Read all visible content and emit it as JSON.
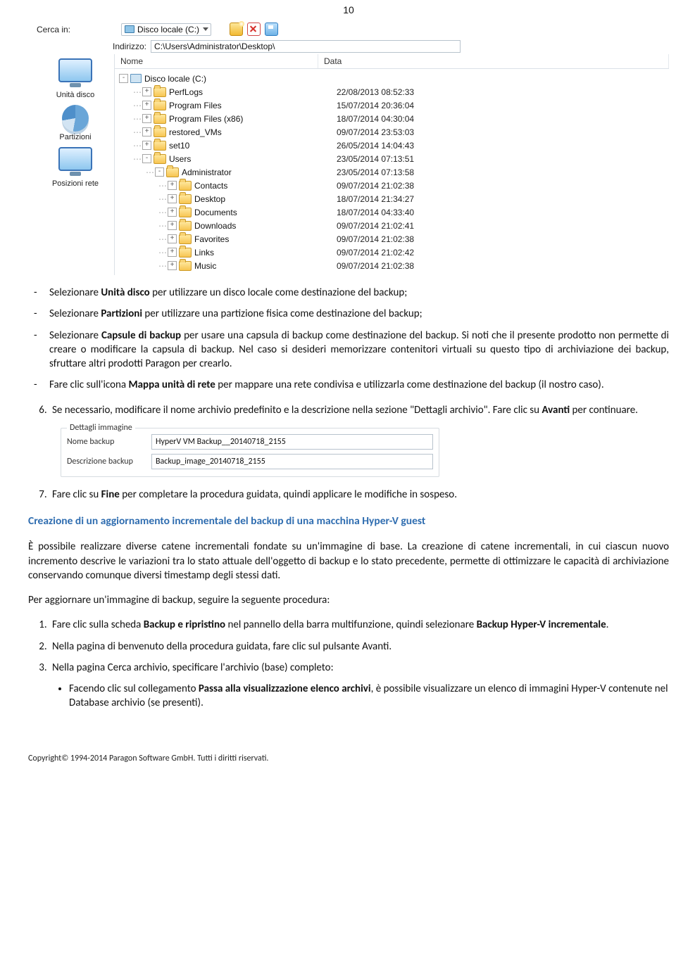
{
  "page_number": "10",
  "browser": {
    "search_label": "Cerca in:",
    "drive_name": "Disco locale (C:)",
    "addr_label": "Indirizzo:",
    "addr_value": "C:\\Users\\Administrator\\Desktop\\",
    "col_name": "Nome",
    "col_data": "Data"
  },
  "side": {
    "unit": "Unità disco",
    "part": "Partizioni",
    "net": "Posizioni rete"
  },
  "tree": [
    {
      "indent": 0,
      "exp": "-",
      "icon": "drive",
      "name": "Disco locale (C:)",
      "date": ""
    },
    {
      "indent": 1,
      "exp": "+",
      "icon": "folder",
      "name": "PerfLogs",
      "date": "22/08/2013 08:52:33"
    },
    {
      "indent": 1,
      "exp": "+",
      "icon": "folder",
      "name": "Program Files",
      "date": "15/07/2014 20:36:04"
    },
    {
      "indent": 1,
      "exp": "+",
      "icon": "folder",
      "name": "Program Files (x86)",
      "date": "18/07/2014 04:30:04"
    },
    {
      "indent": 1,
      "exp": "+",
      "icon": "folder",
      "name": "restored_VMs",
      "date": "09/07/2014 23:53:03"
    },
    {
      "indent": 1,
      "exp": "+",
      "icon": "folder",
      "name": "set10",
      "date": "26/05/2014 14:04:43"
    },
    {
      "indent": 1,
      "exp": "-",
      "icon": "folder",
      "name": "Users",
      "date": "23/05/2014 07:13:51"
    },
    {
      "indent": 2,
      "exp": "-",
      "icon": "folder",
      "name": "Administrator",
      "date": "23/05/2014 07:13:58"
    },
    {
      "indent": 3,
      "exp": "+",
      "icon": "folder",
      "name": "Contacts",
      "date": "09/07/2014 21:02:38"
    },
    {
      "indent": 3,
      "exp": "+",
      "icon": "folder",
      "name": "Desktop",
      "date": "18/07/2014 21:34:27"
    },
    {
      "indent": 3,
      "exp": "+",
      "icon": "folder",
      "name": "Documents",
      "date": "18/07/2014 04:33:40"
    },
    {
      "indent": 3,
      "exp": "+",
      "icon": "folder",
      "name": "Downloads",
      "date": "09/07/2014 21:02:41"
    },
    {
      "indent": 3,
      "exp": "+",
      "icon": "folder",
      "name": "Favorites",
      "date": "09/07/2014 21:02:38"
    },
    {
      "indent": 3,
      "exp": "+",
      "icon": "folder",
      "name": "Links",
      "date": "09/07/2014 21:02:42"
    },
    {
      "indent": 3,
      "exp": "+",
      "icon": "folder",
      "name": "Music",
      "date": "09/07/2014 21:02:38"
    }
  ],
  "text": {
    "b1a": "Selezionare ",
    "b1b": "Unità disco",
    "b1c": " per utilizzare un disco locale come destinazione del backup;",
    "b2a": "Selezionare ",
    "b2b": "Partizioni",
    "b2c": " per utilizzare una partizione fisica come destinazione del backup;",
    "b3a": "Selezionare ",
    "b3b": "Capsule di backup",
    "b3c": " per usare una capsula di backup come destinazione del backup. Si noti che il presente prodotto non permette di creare o modificare la capsula di backup. Nel caso si desideri memorizzare contenitori virtuali su questo tipo di archiviazione dei backup, sfruttare altri prodotti Paragon per crearlo.",
    "b4a": "Fare clic sull'icona ",
    "b4b": "Mappa unità di rete",
    "b4c": " per mappare una rete condivisa e utilizzarla come destinazione del backup (il nostro caso).",
    "n6a": "Se necessario, modificare il nome archivio predefinito e la descrizione nella sezione \"Dettagli archivio\". Fare clic su ",
    "n6b": "Avanti",
    "n6c": " per continuare.",
    "n7a": "Fare clic su ",
    "n7b": "Fine",
    "n7c": " per completare la procedura guidata, quindi applicare le modifiche in sospeso.",
    "section_h": "Creazione di un aggiornamento incrementale del backup di una macchina Hyper-V guest",
    "para1": "È possibile realizzare diverse catene incrementali fondate su un'immagine di base. La creazione di catene incrementali, in cui ciascun nuovo incremento descrive le variazioni tra lo stato attuale dell'oggetto di backup e lo stato precedente, permette di ottimizzare le capacità di archiviazione conservando comunque diversi timestamp degli stessi dati.",
    "para2": "Per aggiornare un'immagine di backup, seguire la seguente procedura:",
    "s1a": "Fare clic sulla scheda ",
    "s1b": "Backup e ripristino",
    "s1c": " nel pannello della barra multifunzione, quindi selezionare ",
    "s1d": "Backup Hyper-V incrementale",
    "s1e": ".",
    "s2": "Nella pagina di benvenuto della procedura guidata, fare clic sul pulsante Avanti.",
    "s3": "Nella pagina Cerca archivio, specificare l'archivio (base) completo:",
    "sb1a": "Facendo clic sul collegamento ",
    "sb1b": "Passa alla visualizzazione elenco archivi",
    "sb1c": ", è possibile visualizzare un elenco di immagini Hyper-V contenute nel Database archivio (se presenti)."
  },
  "details": {
    "legend": "Dettagli immagine",
    "name_label": "Nome backup",
    "name_value": "HyperV VM Backup__20140718_2155",
    "desc_label": "Descrizione backup",
    "desc_value": "Backup_image_20140718_2155"
  },
  "footer": "Copyright© 1994-2014 Paragon Software GmbH. Tutti i diritti riservati."
}
